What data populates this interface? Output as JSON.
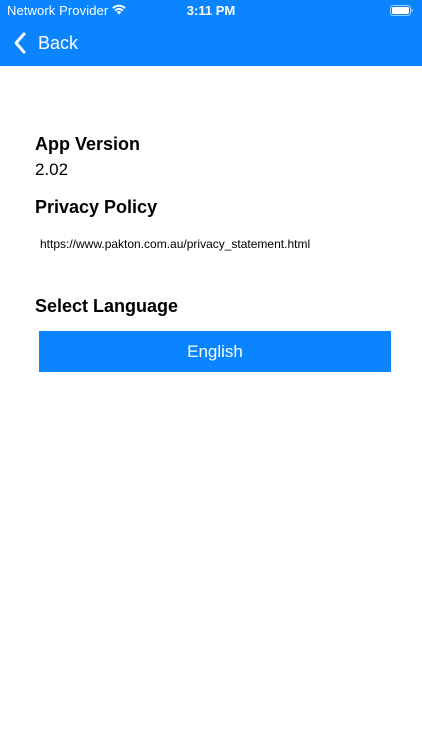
{
  "status_bar": {
    "carrier": "Network Provider",
    "time": "3:11 PM",
    "wifi_icon": "wifi-icon",
    "battery_icon": "battery-icon"
  },
  "nav": {
    "back_label": "Back",
    "back_icon": "chevron-left-icon"
  },
  "app_version": {
    "heading": "App Version",
    "value": "2.02"
  },
  "privacy_policy": {
    "heading": "Privacy Policy",
    "link": "https://www.pakton.com.au/privacy_statement.html"
  },
  "language": {
    "heading": "Select Language",
    "selected": "English"
  },
  "colors": {
    "accent": "#0a84ff",
    "background": "#ffffff",
    "text": "#000000"
  }
}
